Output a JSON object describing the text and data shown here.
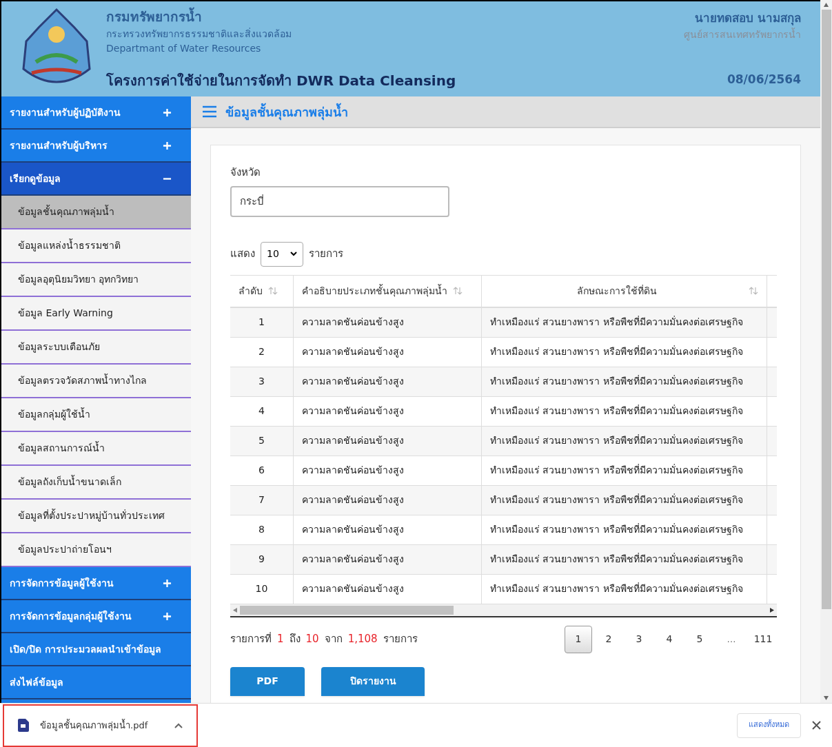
{
  "header": {
    "org_name": "กรมทรัพยากรน้ำ",
    "ministry": "กระทรวงทรัพยากรธรรมชาติและสิ่งแวดล้อม",
    "org_english": "Departmant of Water Resources",
    "project": "โครงการค่าใช้จ่ายในการจัดทำ DWR Data Cleansing",
    "user_name": "นายทดสอบ นามสกุล",
    "user_unit": "ศูนย์สารสนเทศทรัพยากรน้ำ",
    "date": "08/06/2564"
  },
  "sidebar": {
    "sections": [
      {
        "label": "รายงานสำหรับผู้ปฏิบัติงาน",
        "kind": "toggle",
        "expanded": false
      },
      {
        "label": "รายงานสำหรับผู้บริหาร",
        "kind": "toggle",
        "expanded": false
      },
      {
        "label": "เรียกดูข้อมูล",
        "kind": "toggle",
        "expanded": true,
        "children": [
          {
            "label": "ข้อมูลชั้นคุณภาพลุ่มน้ำ",
            "selected": true
          },
          {
            "label": "ข้อมูลแหล่งน้ำธรรมชาติ",
            "selected": false
          },
          {
            "label": "ข้อมูลอุตุนิยมวิทยา อุทกวิทยา",
            "selected": false
          },
          {
            "label": "ข้อมูล Early Warning",
            "selected": false
          },
          {
            "label": "ข้อมูลระบบเตือนภัย",
            "selected": false
          },
          {
            "label": "ข้อมูลตรวจวัดสภาพน้ำทางไกล",
            "selected": false
          },
          {
            "label": "ข้อมูลกลุ่มผู้ใช้น้ำ",
            "selected": false
          },
          {
            "label": "ข้อมูลสถานการณ์น้ำ",
            "selected": false
          },
          {
            "label": "ข้อมูลถังเก็บน้ำขนาดเล็ก",
            "selected": false
          },
          {
            "label": "ข้อมูลที่ตั้งประปาหมู่บ้านทั่วประเทศ",
            "selected": false
          },
          {
            "label": "ข้อมูลประปาถ่ายโอนฯ",
            "selected": false
          }
        ]
      },
      {
        "label": "การจัดการข้อมูลผู้ใช้งาน",
        "kind": "toggle",
        "expanded": false
      },
      {
        "label": "การจัดการข้อมูลกลุ่มผู้ใช้งาน",
        "kind": "toggle",
        "expanded": false
      },
      {
        "label": "เปิด/ปิด การประมวลผลนำเข้าข้อมูล",
        "kind": "link"
      },
      {
        "label": "ส่งไฟล์ข้อมูล",
        "kind": "link"
      }
    ]
  },
  "page_title": "ข้อมูลชั้นคุณภาพลุ่มน้ำ",
  "filter": {
    "label": "จังหวัด",
    "value": "กระบี่"
  },
  "page_size": {
    "before": "แสดง",
    "value": "10",
    "after": "รายการ"
  },
  "table": {
    "columns": [
      "ลำดับ",
      "คำอธิบายประเภทชั้นคุณภาพลุ่มน้ำ",
      "ลักษณะการใช้ที่ดิน"
    ],
    "rows": [
      [
        "1",
        "ความลาดชันค่อนข้างสูง",
        "ทำเหมืองแร่ สวนยางพารา หรือพืชที่มีความมั่นคงต่อเศรษฐกิจ"
      ],
      [
        "2",
        "ความลาดชันค่อนข้างสูง",
        "ทำเหมืองแร่ สวนยางพารา หรือพืชที่มีความมั่นคงต่อเศรษฐกิจ"
      ],
      [
        "3",
        "ความลาดชันค่อนข้างสูง",
        "ทำเหมืองแร่ สวนยางพารา หรือพืชที่มีความมั่นคงต่อเศรษฐกิจ"
      ],
      [
        "4",
        "ความลาดชันค่อนข้างสูง",
        "ทำเหมืองแร่ สวนยางพารา หรือพืชที่มีความมั่นคงต่อเศรษฐกิจ"
      ],
      [
        "5",
        "ความลาดชันค่อนข้างสูง",
        "ทำเหมืองแร่ สวนยางพารา หรือพืชที่มีความมั่นคงต่อเศรษฐกิจ"
      ],
      [
        "6",
        "ความลาดชันค่อนข้างสูง",
        "ทำเหมืองแร่ สวนยางพารา หรือพืชที่มีความมั่นคงต่อเศรษฐกิจ"
      ],
      [
        "7",
        "ความลาดชันค่อนข้างสูง",
        "ทำเหมืองแร่ สวนยางพารา หรือพืชที่มีความมั่นคงต่อเศรษฐกิจ"
      ],
      [
        "8",
        "ความลาดชันค่อนข้างสูง",
        "ทำเหมืองแร่ สวนยางพารา หรือพืชที่มีความมั่นคงต่อเศรษฐกิจ"
      ],
      [
        "9",
        "ความลาดชันค่อนข้างสูง",
        "ทำเหมืองแร่ สวนยางพารา หรือพืชที่มีความมั่นคงต่อเศรษฐกิจ"
      ],
      [
        "10",
        "ความลาดชันค่อนข้างสูง",
        "ทำเหมืองแร่ สวนยางพารา หรือพืชที่มีความมั่นคงต่อเศรษฐกิจ"
      ]
    ]
  },
  "summary": [
    {
      "text": "รายการที่",
      "highlight": false
    },
    {
      "text": "1",
      "highlight": true
    },
    {
      "text": "ถึง",
      "highlight": false
    },
    {
      "text": "10",
      "highlight": true
    },
    {
      "text": "จาก",
      "highlight": false
    },
    {
      "text": "1,108",
      "highlight": true
    },
    {
      "text": "รายการ",
      "highlight": false
    }
  ],
  "pagination": [
    {
      "label": "1",
      "selected": true
    },
    {
      "label": "2",
      "selected": false
    },
    {
      "label": "3",
      "selected": false
    },
    {
      "label": "4",
      "selected": false
    },
    {
      "label": "5",
      "selected": false
    },
    {
      "label": "…",
      "kind": "gap"
    },
    {
      "label": "111",
      "selected": false
    }
  ],
  "buttons": [
    "PDF",
    "ปิดรายงาน"
  ],
  "download_bar": {
    "file_name": "ข้อมูลชั้นคุณภาพลุ่มน้ำ.pdf",
    "show_all": "แสดงทั้งหมด"
  }
}
